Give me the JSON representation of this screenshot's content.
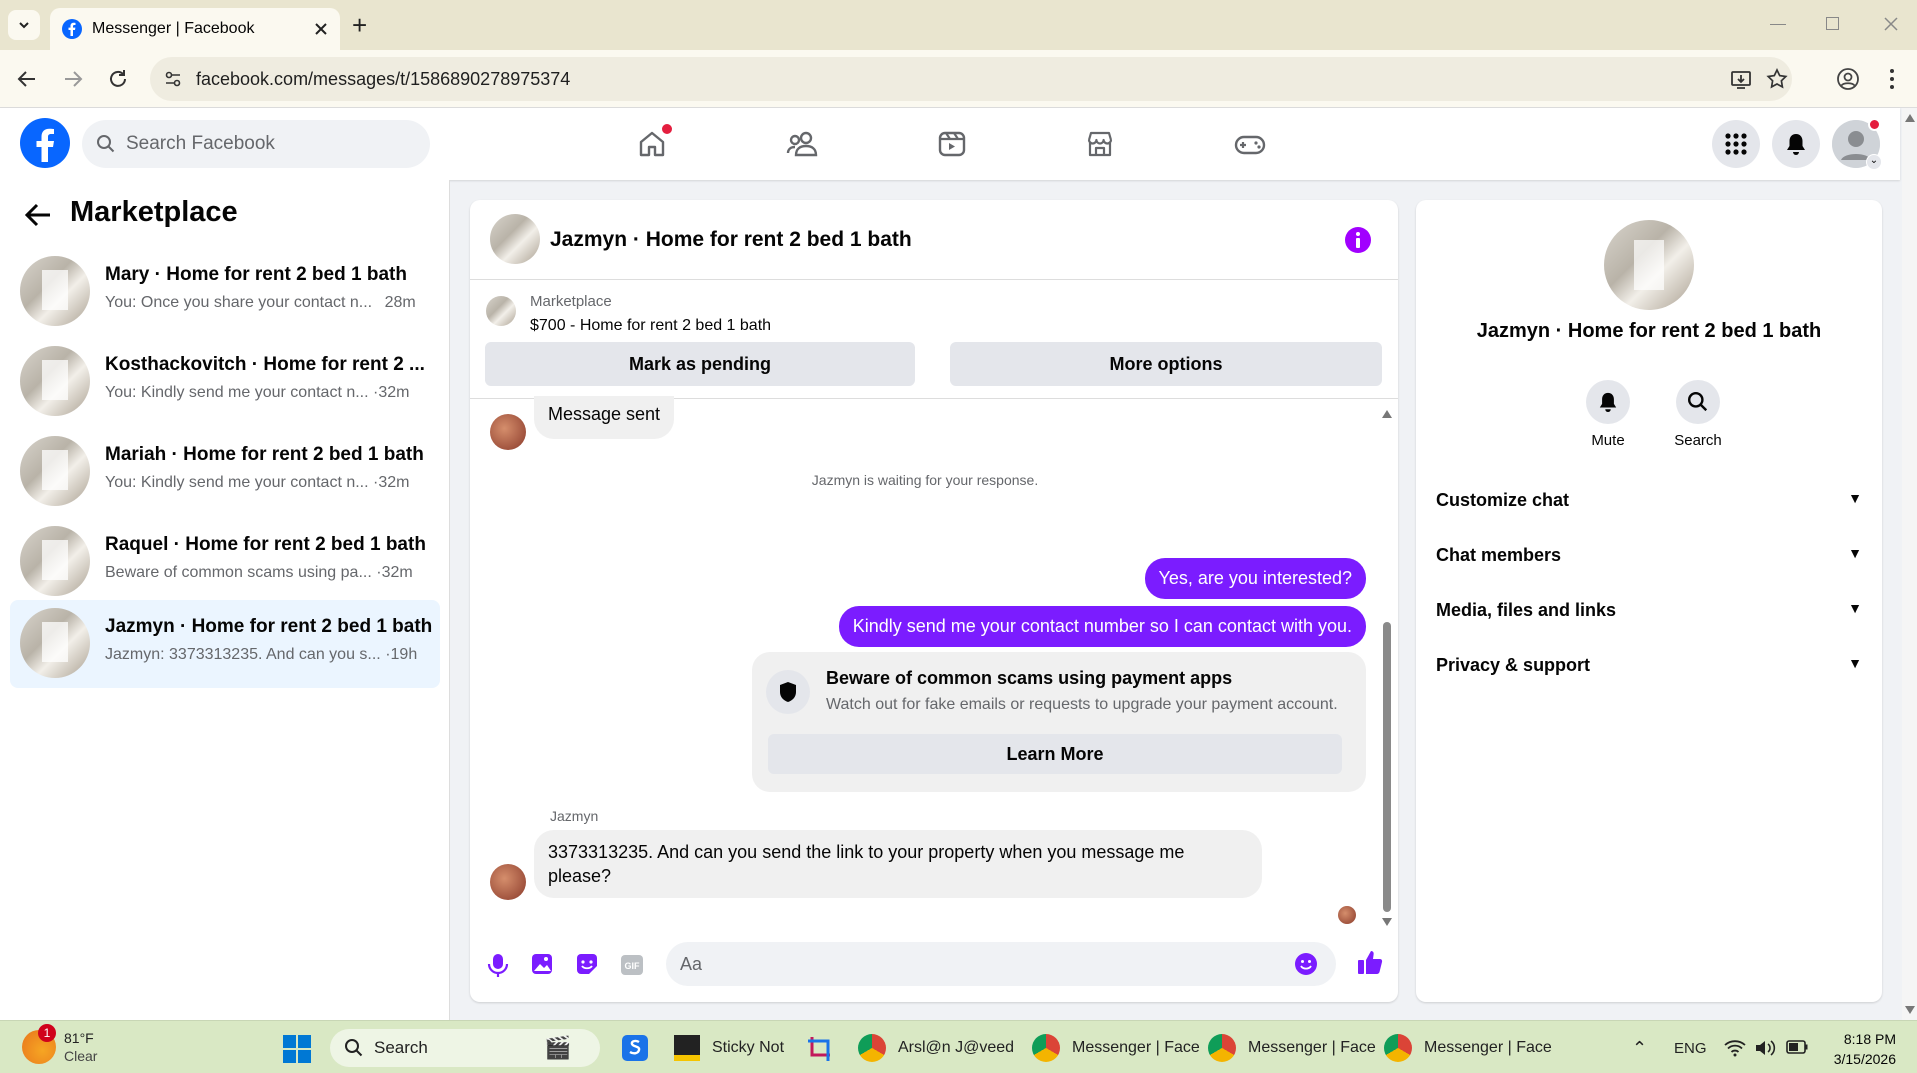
{
  "browser": {
    "tab_title": "Messenger | Facebook",
    "new_tab": "+",
    "url": "facebook.com/messages/t/1586890278975374"
  },
  "header": {
    "search_placeholder": "Search Facebook"
  },
  "left": {
    "title": "Marketplace",
    "conversations": [
      {
        "name": "Mary · Home for rent 2 bed 1 bath",
        "preview": "You: Once you share your contact n...",
        "time": "28m"
      },
      {
        "name": "Kosthackovitch · Home for rent 2 ...",
        "preview": "You: Kindly send me your contact n...",
        "time": "·32m"
      },
      {
        "name": "Mariah · Home for rent 2 bed 1 bath",
        "preview": "You: Kindly send me your contact n...",
        "time": "·32m"
      },
      {
        "name": "Raquel · Home for rent 2 bed 1 bath",
        "preview": "Beware of common scams using pa...",
        "time": "·32m"
      },
      {
        "name": "Jazmyn · Home for rent 2 bed 1 bath",
        "preview": "Jazmyn: 3373313235. And can you s...",
        "time": "·19h"
      }
    ]
  },
  "chat": {
    "title": "Jazmyn · Home for rent 2 bed 1 bath",
    "listing_label": "Marketplace",
    "listing_price": "$700 - Home for rent 2 bed 1 bath",
    "mark_pending": "Mark as pending",
    "more_options": "More options",
    "msg_sent": "Message sent",
    "waiting": "Jazmyn is waiting for your response.",
    "out1": "Yes, are you interested?",
    "out2": "Kindly send me your contact number so I can contact with you.",
    "scam_title": "Beware of common scams using payment apps",
    "scam_body": "Watch out for fake emails or requests to upgrade your payment account.",
    "learn_more": "Learn More",
    "sender": "Jazmyn",
    "in_line1": "3373313235. And can you send the link to your property when you message me",
    "in_line2": "please?",
    "composer_placeholder": "Aa"
  },
  "right": {
    "name": "Jazmyn · Home for rent 2 bed 1 bath",
    "mute": "Mute",
    "search": "Search",
    "sections": [
      "Customize chat",
      "Chat members",
      "Media, files and links",
      "Privacy & support"
    ]
  },
  "taskbar": {
    "weather_temp": "81°F",
    "weather_desc": "Clear",
    "weather_badge": "1",
    "search": "Search",
    "apps": [
      "Sticky Not",
      "Arsl@n J@veed",
      "Messenger | Face",
      "Messenger | Face",
      "Messenger | Face"
    ],
    "lang": "ENG",
    "time": "8:18 PM",
    "date": "3/15/2026"
  },
  "colors": {
    "fb_blue": "#0866ff",
    "messenger_purple": "#7b1cff",
    "notif_red": "#e41e3f"
  }
}
